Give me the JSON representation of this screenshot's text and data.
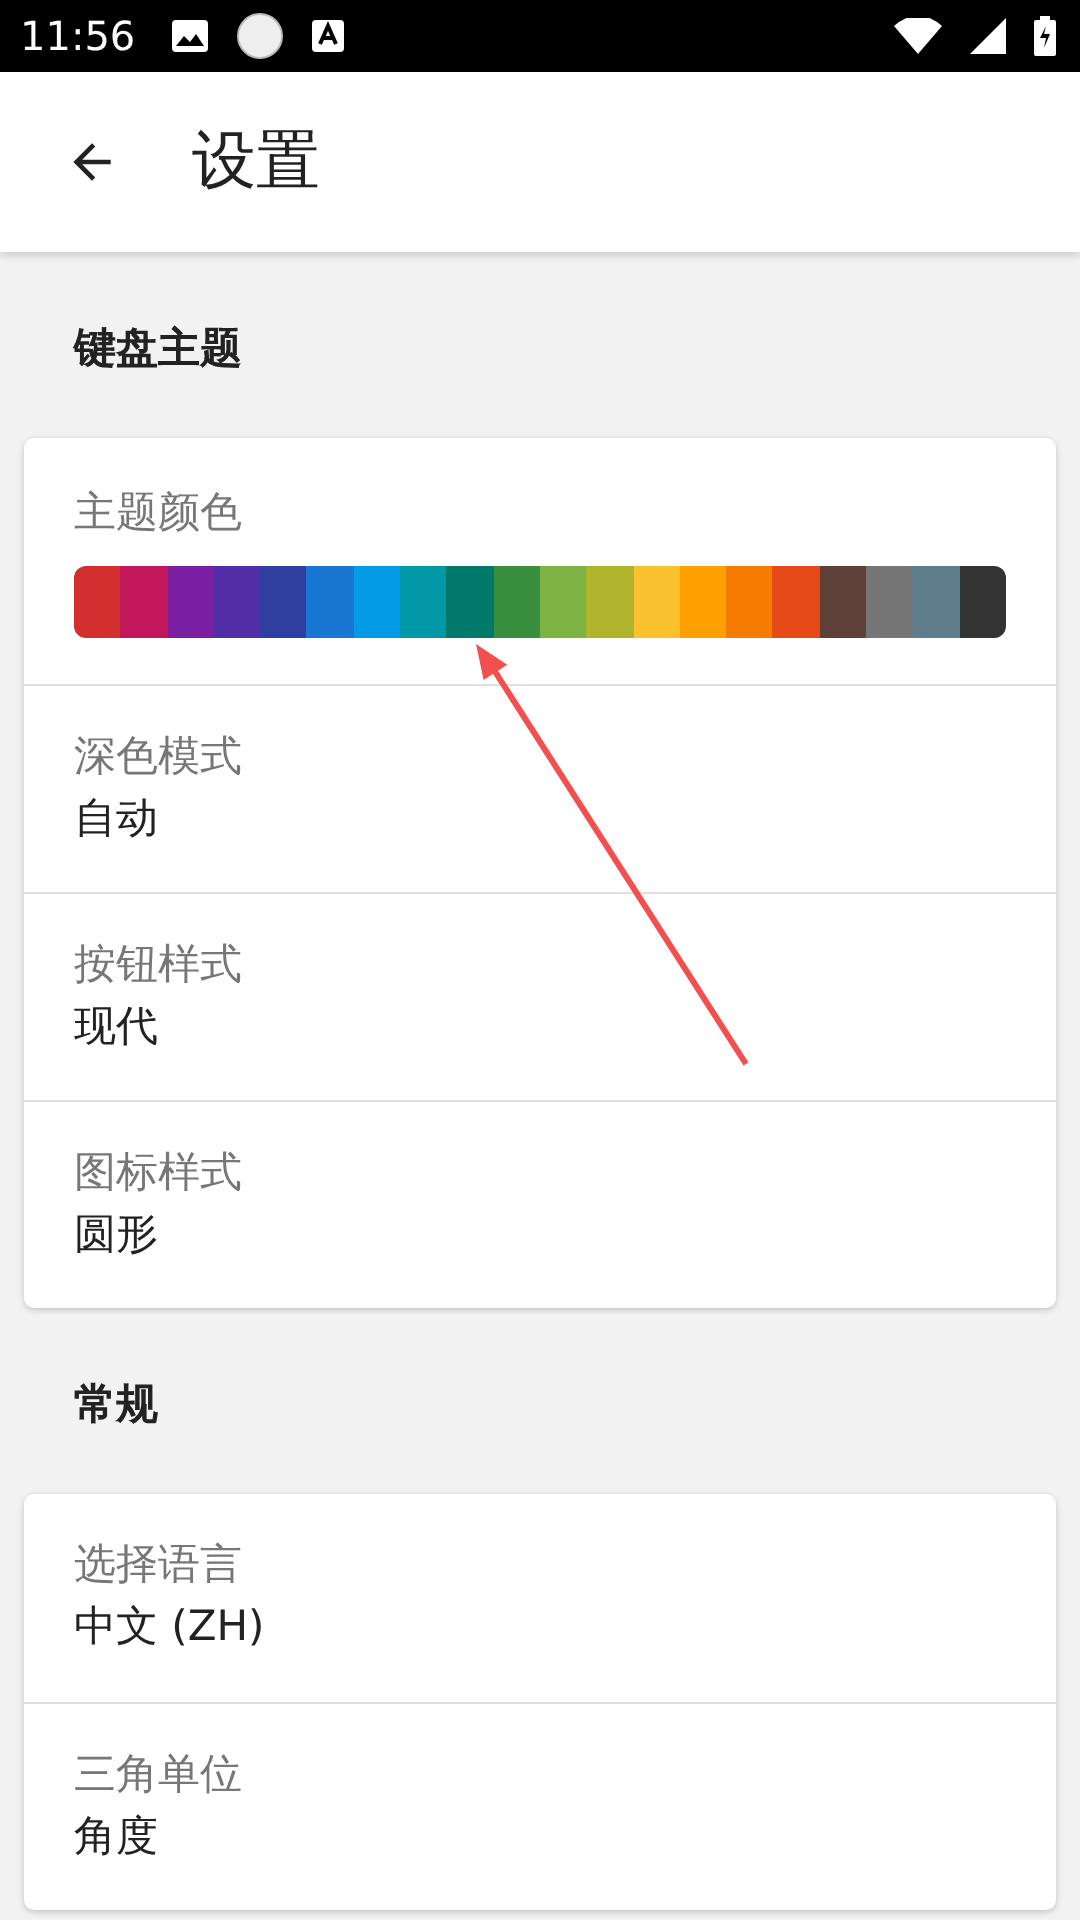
{
  "status_bar": {
    "time": "11:56"
  },
  "app_bar": {
    "title": "设置"
  },
  "sections": [
    {
      "title": "键盘主题",
      "items": [
        {
          "kind": "palette",
          "label": "主题颜色",
          "swatches": [
            {
              "color": "#d32f2f"
            },
            {
              "color": "#c2185b"
            },
            {
              "color": "#7b1fa2"
            },
            {
              "color": "#512da8"
            },
            {
              "color": "#303f9f"
            },
            {
              "color": "#1976d2"
            },
            {
              "color": "#039be5"
            },
            {
              "color": "#0097a7"
            },
            {
              "color": "#00796b"
            },
            {
              "color": "#388e3c"
            },
            {
              "color": "#7cb342"
            },
            {
              "color": "#afb42b"
            },
            {
              "color": "#fbc02d"
            },
            {
              "color": "#ffa000"
            },
            {
              "color": "#f57c00"
            },
            {
              "color": "#e64a19"
            },
            {
              "color": "#5d4037"
            },
            {
              "color": "#757575"
            },
            {
              "color": "#607d8b"
            },
            {
              "color": "#333333"
            }
          ]
        },
        {
          "kind": "value",
          "label": "深色模式",
          "value": "自动"
        },
        {
          "kind": "value",
          "label": "按钮样式",
          "value": "现代"
        },
        {
          "kind": "value",
          "label": "图标样式",
          "value": "圆形"
        }
      ]
    },
    {
      "title": "常规",
      "items": [
        {
          "kind": "value",
          "label": "选择语言",
          "value": "中文 (ZH)"
        },
        {
          "kind": "value",
          "label": "三角单位",
          "value": "角度"
        }
      ]
    }
  ]
}
